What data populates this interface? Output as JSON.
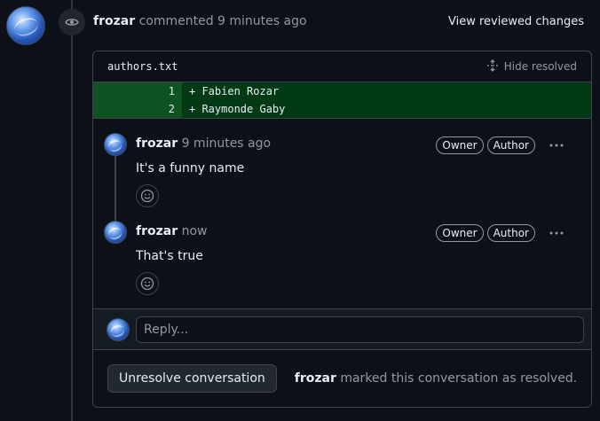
{
  "header": {
    "author": "frozar",
    "action": "commented 9 minutes ago",
    "view_reviewed_label": "View reviewed changes"
  },
  "file": {
    "name": "authors.txt",
    "hide_resolved_label": "Hide resolved"
  },
  "diff": [
    {
      "line": "1",
      "code": "+ Fabien Rozar"
    },
    {
      "line": "2",
      "code": "+ Raymonde Gaby"
    }
  ],
  "comments": [
    {
      "author": "frozar",
      "time": "9 minutes ago",
      "body": "It's a funny name",
      "badges": [
        "Owner",
        "Author"
      ]
    },
    {
      "author": "frozar",
      "time": "now",
      "body": "That's true",
      "badges": [
        "Owner",
        "Author"
      ]
    }
  ],
  "reply": {
    "placeholder": "Reply..."
  },
  "footer": {
    "unresolve_label": "Unresolve conversation",
    "resolved_author": "frozar",
    "resolved_text": "marked this conversation as resolved."
  },
  "colors": {
    "background": "#0d1117",
    "diff_add": "#033a16",
    "diff_add_gutter": "#0f5323",
    "border": "#3d444d"
  },
  "icons": [
    "eye-icon",
    "unfold-icon",
    "kebab-icon",
    "smiley-icon"
  ]
}
